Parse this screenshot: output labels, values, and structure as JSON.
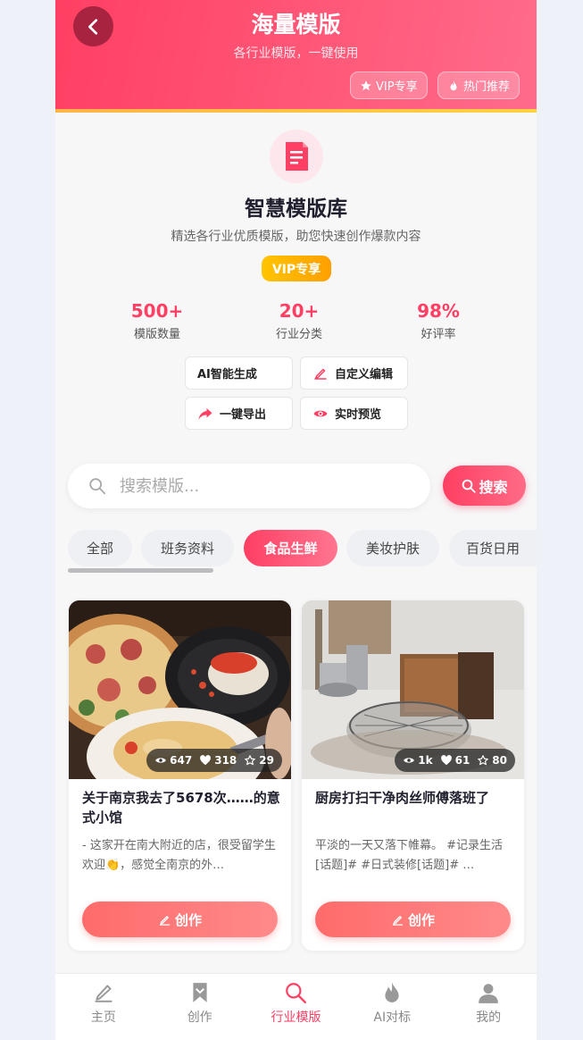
{
  "header": {
    "title": "海量模版",
    "subtitle": "各行业模版，一键使用",
    "badges": [
      {
        "label": "VIP专享",
        "icon": "star-icon"
      },
      {
        "label": "热门推荐",
        "icon": "fire-icon"
      }
    ]
  },
  "intro": {
    "icon": "document-icon",
    "title": "智慧模版库",
    "description": "精选各行业优质模版，助您快速创作爆款内容",
    "vip_label": "VIP专享",
    "stats": [
      {
        "value": "500+",
        "label": "模版数量"
      },
      {
        "value": "20+",
        "label": "行业分类"
      },
      {
        "value": "98%",
        "label": "好评率"
      }
    ],
    "features": [
      {
        "label": "AI智能生成",
        "icon": ""
      },
      {
        "label": "自定义编辑",
        "icon": "edit-icon"
      },
      {
        "label": "一键导出",
        "icon": "share-icon"
      },
      {
        "label": "实时预览",
        "icon": "eye-icon"
      }
    ]
  },
  "search": {
    "placeholder": "搜索模版...",
    "value": "",
    "button_label": "搜索"
  },
  "categories": {
    "items": [
      "全部",
      "班务资料",
      "食品生鲜",
      "美妆护肤",
      "百货日用"
    ],
    "active": "食品生鲜"
  },
  "cards": [
    {
      "title": "关于南京我去了5678次……的意式小馆",
      "description": "- 这家开在南大附近的店，很受留学生欢迎👏，感觉全南京的外…",
      "views": "647",
      "likes": "318",
      "favorites": "29",
      "button_label": "创作"
    },
    {
      "title": "厨房打扫干净肉丝师傅落班了",
      "description": "平淡的一天又落下帷幕。 #记录生活[话题]# #日式装修[话题]# …",
      "views": "1k",
      "likes": "61",
      "favorites": "80",
      "button_label": "创作"
    }
  ],
  "bottom_nav": {
    "items": [
      {
        "label": "主页",
        "icon": "pencil-icon"
      },
      {
        "label": "创作",
        "icon": "bookmark-icon"
      },
      {
        "label": "行业模版",
        "icon": "search-icon"
      },
      {
        "label": "AI对标",
        "icon": "fire-icon"
      },
      {
        "label": "我的",
        "icon": "user-icon"
      }
    ],
    "active": "行业模版"
  },
  "colors": {
    "accent": "#ff3f63",
    "vip": "#ffb400",
    "create_button": "#ff6b6b"
  }
}
